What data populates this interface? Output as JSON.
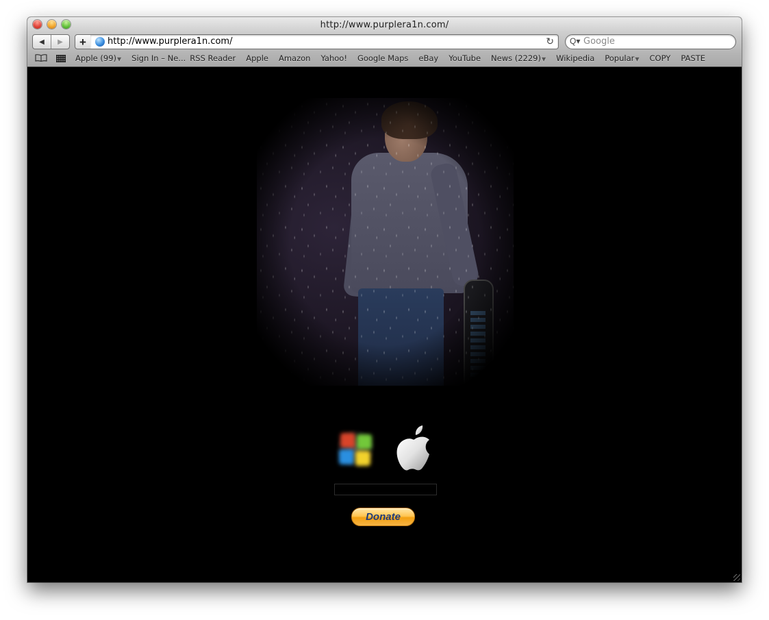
{
  "window": {
    "title": "http://www.purplera1n.com/"
  },
  "toolbar": {
    "back_icon": "◀",
    "forward_icon": "▶",
    "add_bookmark_icon": "+",
    "url": "http://www.purplera1n.com/",
    "reload_icon": "↻",
    "search_icon": "Q▾",
    "search_placeholder": "Google"
  },
  "bookmarks_bar": {
    "book_icon": "📖",
    "items": [
      {
        "label": "Apple (99)",
        "has_menu": true
      },
      {
        "label": "Sign In – Ne...",
        "has_menu": false
      },
      {
        "label": "RSS Reader",
        "has_menu": false
      },
      {
        "label": "Apple",
        "has_menu": false
      },
      {
        "label": "Amazon",
        "has_menu": false
      },
      {
        "label": "Yahoo!",
        "has_menu": false
      },
      {
        "label": "Google Maps",
        "has_menu": false
      },
      {
        "label": "eBay",
        "has_menu": false
      },
      {
        "label": "YouTube",
        "has_menu": false
      },
      {
        "label": "News (2229)",
        "has_menu": true
      },
      {
        "label": "Wikipedia",
        "has_menu": false
      },
      {
        "label": "Popular",
        "has_menu": true
      },
      {
        "label": "COPY",
        "has_menu": false
      },
      {
        "label": "PASTE",
        "has_menu": false
      }
    ],
    "menu_arrow": "▼"
  },
  "page": {
    "hero_image": "person-in-rain-with-giant-iphone",
    "os_options": [
      {
        "name": "windows",
        "icon": "windows-logo-icon"
      },
      {
        "name": "mac",
        "icon": "apple-logo-icon"
      }
    ],
    "input_value": "",
    "donate_label": "Donate"
  }
}
